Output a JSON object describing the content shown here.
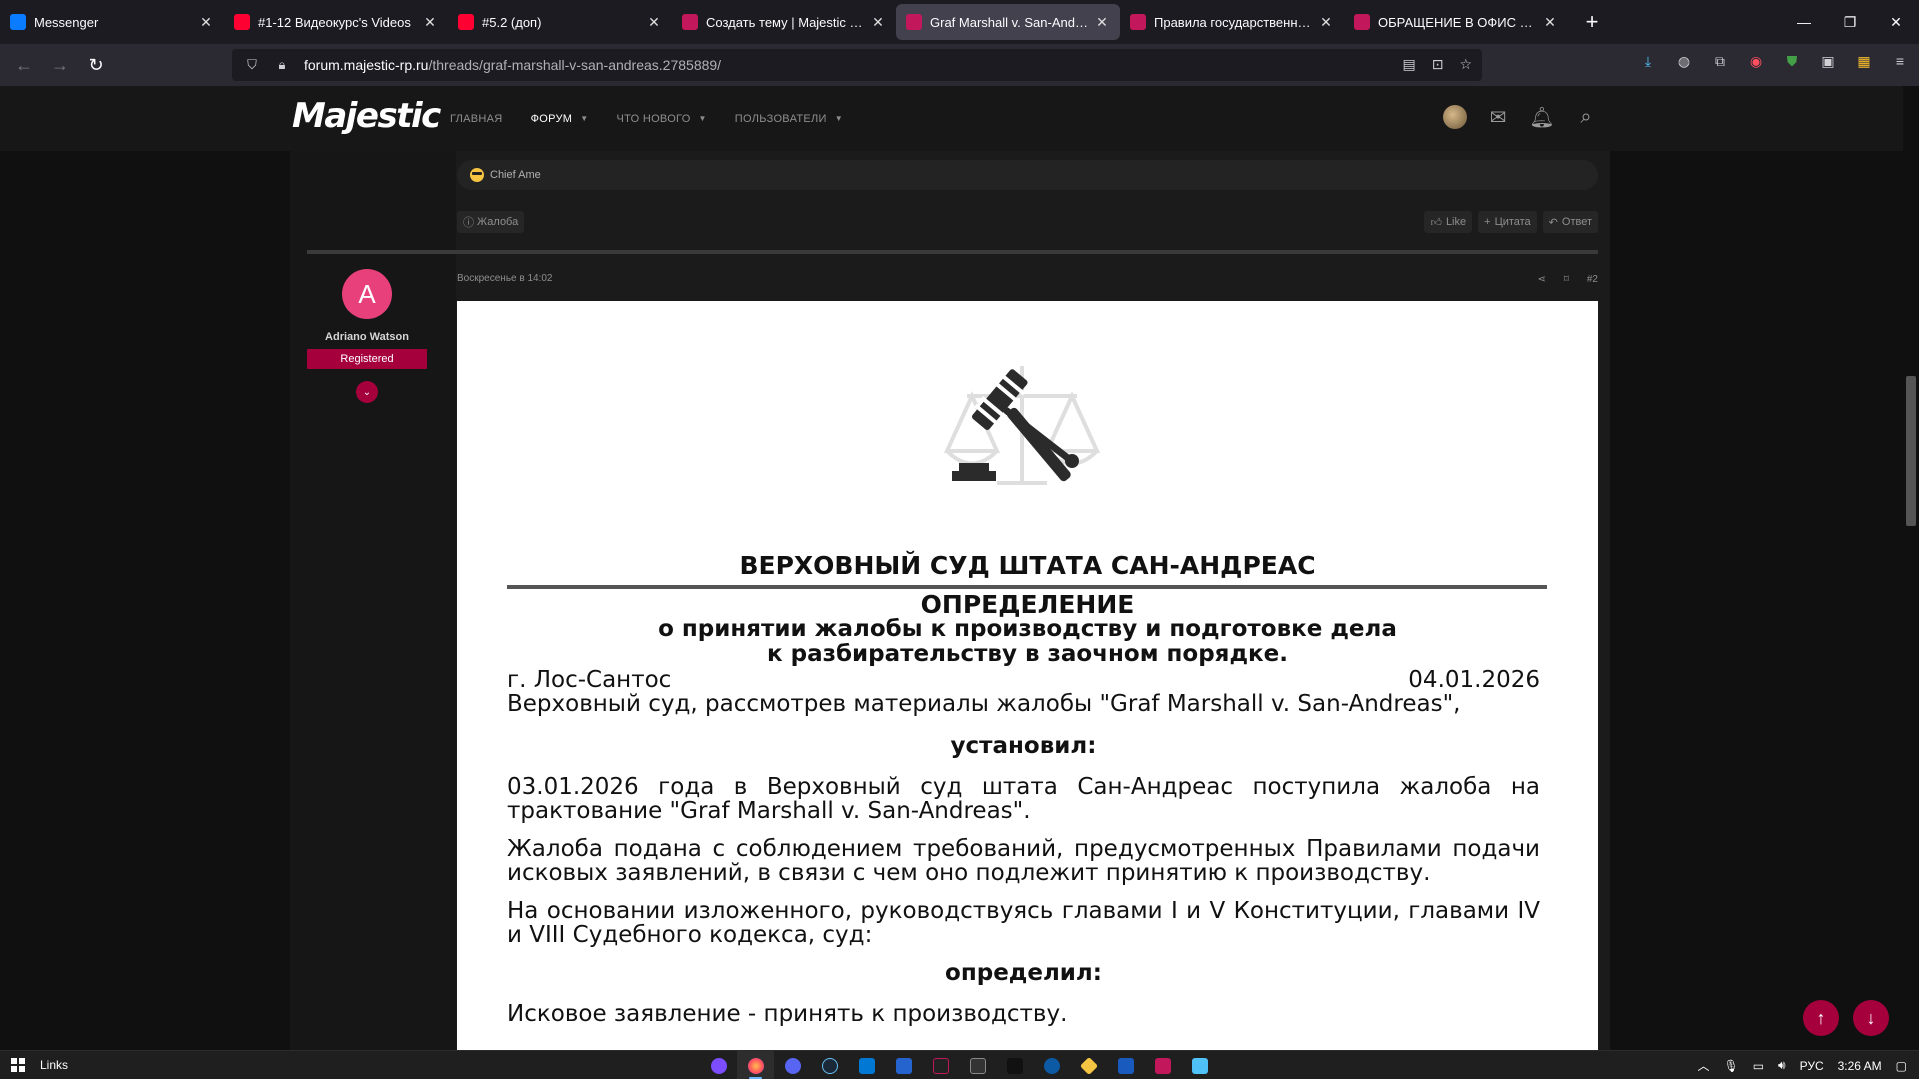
{
  "browser": {
    "tabs": [
      {
        "title": "Messenger",
        "favicon": "messenger-icon",
        "color": "#0a7cff"
      },
      {
        "title": "#1-12 Видеокурс's Videos",
        "favicon": "youtube-icon",
        "color": "#ff0033"
      },
      {
        "title": "#5.2 (доп)",
        "favicon": "youtube-icon",
        "color": "#ff0033"
      },
      {
        "title": "Создать тему | Majestic Role Play",
        "favicon": "majestic-icon",
        "color": "#c2185b"
      },
      {
        "title": "Graf Marshall v. San-Andreas | Majestic",
        "favicon": "majestic-icon",
        "color": "#c2185b",
        "active": true
      },
      {
        "title": "Правила государственных организаций",
        "favicon": "majestic-icon",
        "color": "#c2185b"
      },
      {
        "title": "ОБРАЩЕНИЕ В ОФИС ГЕНЕРАЛЬНОГО",
        "favicon": "majestic-icon",
        "color": "#c2185b"
      }
    ],
    "url_host": "forum.majestic-rp.ru",
    "url_path": "/threads/graf-marshall-v-san-andreas.2785889/"
  },
  "site": {
    "logo": "Majestic",
    "menu": {
      "home": "ГЛАВНАЯ",
      "forum": "ФОРУМ",
      "whats_new": "ЧТО НОВОГО",
      "users": "ПОЛЬЗОВАТЕЛИ"
    }
  },
  "prev_post": {
    "quote_user": "Chief Ame",
    "report": "Жалоба",
    "like": "Like",
    "quote": "Цитата",
    "reply": "Ответ"
  },
  "post": {
    "author": {
      "initial": "A",
      "name": "Adriano Watson",
      "role": "Registered"
    },
    "date": "Воскресенье в 14:02",
    "number": "#2",
    "document": {
      "court": "ВЕРХОВНЫЙ СУД ШТАТА САН-АНДРЕАС",
      "title": "ОПРЕДЕЛЕНИЕ",
      "subtitle_1": "о принятии жалобы к производству и подготовке дела",
      "subtitle_2": "к разбирательству в заочном порядке.",
      "city": "г. Лос-Сантос",
      "date": "04.01.2026",
      "intro": "Верховный суд, рассмотрев материалы жалобы \"Graf Marshall v. San-Andreas\",",
      "established": "установил:",
      "p1": "03.01.2026 года в Верховный суд штата Сан-Андреас поступила жалоба на трактование \"Graf Marshall v. San-Andreas\".",
      "p2": "Жалоба подана с соблюдением требований, предусмотренных Правилами подачи исковых заявлений, в связи с чем оно подлежит принятию к производству.",
      "p3": "На основании изложенного, руководствуясь главами I и V Конституции, главами IV и VIII Судебного кодекса, суд:",
      "determined": "определил:",
      "p4": "Исковое заявление - принять к производству."
    }
  },
  "taskbar": {
    "links": "Links",
    "lang": "РУС",
    "time": "3:26 AM"
  }
}
